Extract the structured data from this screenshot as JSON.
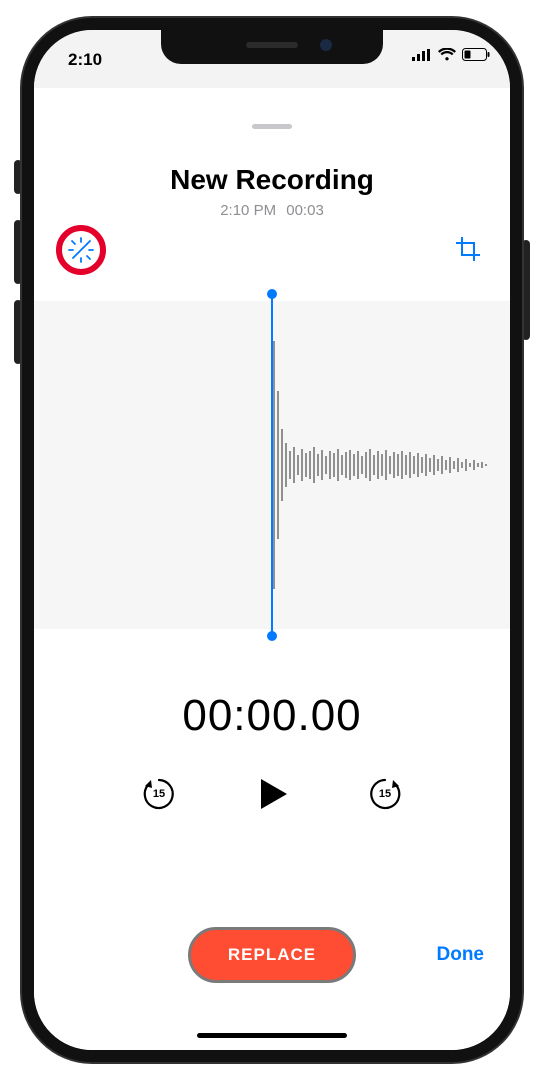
{
  "status": {
    "time": "2:10"
  },
  "header": {
    "title": "New Recording",
    "time": "2:10 PM",
    "duration": "00:03"
  },
  "controls": {
    "enhance_label": "magic-enhance",
    "crop_label": "trim-crop",
    "skip_seconds": "15"
  },
  "timer": "00:00.00",
  "actions": {
    "replace": "REPLACE",
    "done": "Done"
  },
  "colors": {
    "accent": "#007aff",
    "highlight": "#e4002b",
    "record": "#ff4d34"
  }
}
